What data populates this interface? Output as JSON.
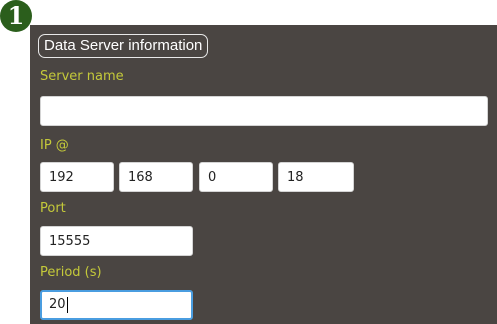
{
  "badge": {
    "label": "1"
  },
  "section": {
    "title": "Data Server information"
  },
  "server_name": {
    "label": "Server name",
    "value": ""
  },
  "ip": {
    "label": "IP @",
    "octets": [
      "192",
      "168",
      "0",
      "18"
    ]
  },
  "port": {
    "label": "Port",
    "value": "15555"
  },
  "period": {
    "label": "Period (s)",
    "value": "20"
  },
  "colors": {
    "panel_bg": "#4a4542",
    "label": "#c4c93a",
    "badge_bg": "#2b5e1c",
    "focus_border": "#4a9de0"
  }
}
